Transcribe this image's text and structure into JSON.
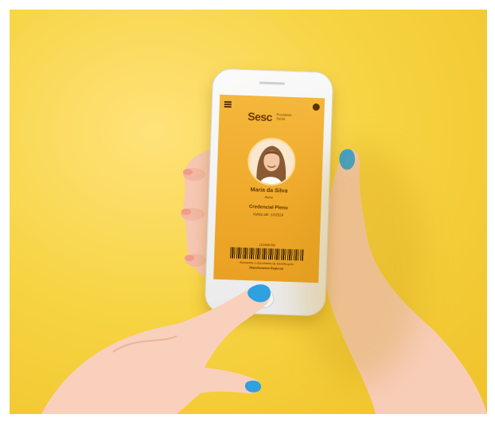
{
  "card": {
    "brand": "Sesc",
    "brand_sub": "Presidente Social",
    "name": "Maria da Silva",
    "role": "Aluna",
    "credential_title": "Credencial Pleno",
    "credential_subtitle": "Valida até: 12/2024",
    "barcode_number": "123456789",
    "footer_line1": "Apresente o documento de identificação",
    "footer_line2": "Departamento Regional"
  },
  "colors": {
    "background": "#f7d443",
    "card": "#f0ad2e",
    "nail_polish": "#2fa0e0",
    "text": "#5a3300"
  },
  "icons": {
    "menu": "menu-icon",
    "profile": "profile-icon"
  }
}
